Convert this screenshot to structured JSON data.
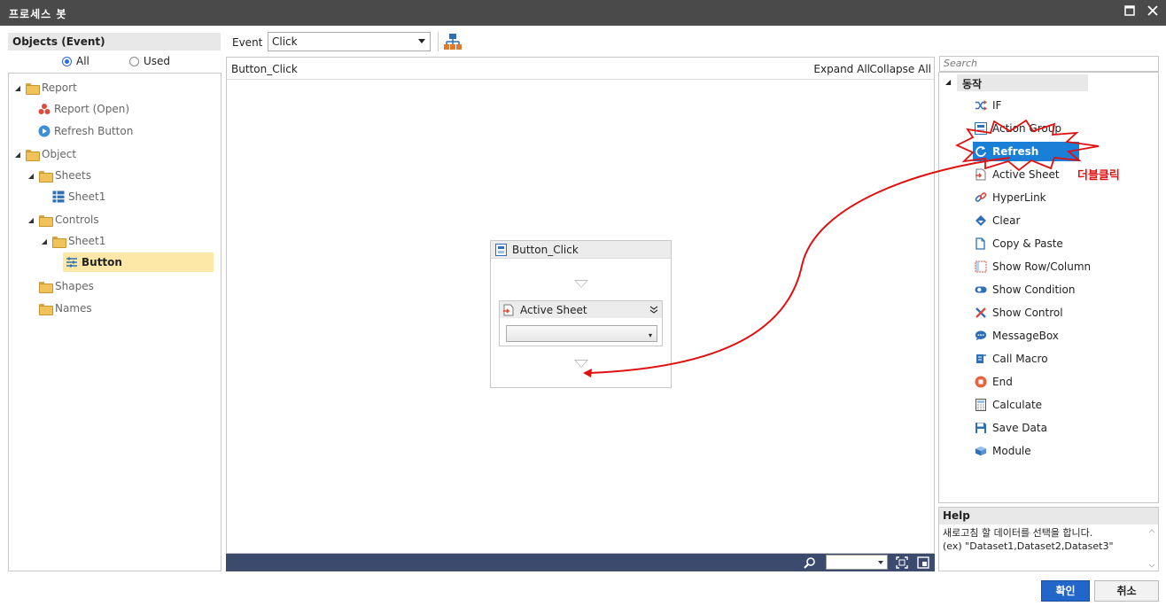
{
  "window": {
    "title": "프로세스 봇"
  },
  "left": {
    "header": "Objects (Event)",
    "radio_all": "All",
    "radio_used": "Used",
    "tree": [
      {
        "label": "Report"
      },
      {
        "label": "Report (Open)"
      },
      {
        "label": "Refresh Button"
      },
      {
        "label": "Object"
      },
      {
        "label": "Sheets"
      },
      {
        "label": "Sheet1"
      },
      {
        "label": "Controls"
      },
      {
        "label": "Sheet1"
      },
      {
        "label": "Button"
      },
      {
        "label": "Shapes"
      },
      {
        "label": "Names"
      }
    ]
  },
  "toolbar": {
    "event_label": "Event",
    "event_value": "Click"
  },
  "canvas": {
    "event_name": "Button_Click",
    "expand_all": "Expand All",
    "collapse_all": "Collapse All",
    "flow_title": "Button_Click",
    "action_title": "Active Sheet"
  },
  "right": {
    "search_placeholder": "Search",
    "group": "동작",
    "actions": [
      {
        "label": "IF"
      },
      {
        "label": "Action Group"
      },
      {
        "label": "Refresh"
      },
      {
        "label": "Active Sheet"
      },
      {
        "label": "HyperLink"
      },
      {
        "label": "Clear"
      },
      {
        "label": "Copy & Paste"
      },
      {
        "label": "Show Row/Column"
      },
      {
        "label": "Show Condition"
      },
      {
        "label": "Show Control"
      },
      {
        "label": "MessageBox"
      },
      {
        "label": "Call Macro"
      },
      {
        "label": "End"
      },
      {
        "label": "Calculate"
      },
      {
        "label": "Save Data"
      },
      {
        "label": "Module"
      }
    ],
    "annotation": "더블클릭",
    "help_title": "Help",
    "help_line1": "새로고침 할 데이터를 선택을 합니다.",
    "help_line2": "(ex) \"Dataset1,Dataset2,Dataset3\""
  },
  "buttons": {
    "ok": "확인",
    "cancel": "취소"
  },
  "colors": {
    "accent": "#1a7fd6",
    "annotation": "#e01010",
    "titlebar": "#4a4a4a",
    "selection": "#fde8a8"
  }
}
